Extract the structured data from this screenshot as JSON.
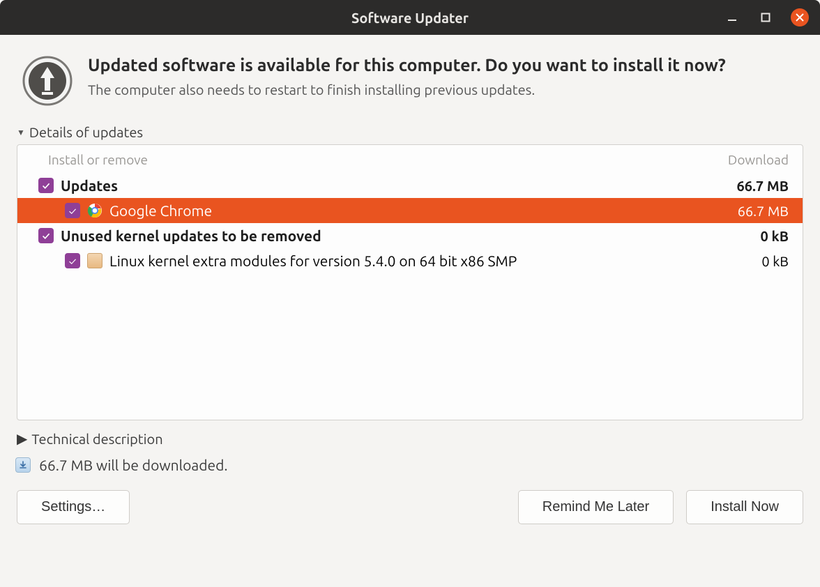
{
  "titlebar": {
    "title": "Software Updater"
  },
  "header": {
    "heading": "Updated software is available for this computer. Do you want to install it now?",
    "subheading": "The computer also needs to restart to finish installing previous updates."
  },
  "expanders": {
    "details": "Details of updates",
    "technical": "Technical description"
  },
  "columns": {
    "left": "Install or remove",
    "right": "Download"
  },
  "updates": {
    "group1": {
      "label": "Updates",
      "size": "66.7 MB"
    },
    "chrome": {
      "label": "Google Chrome",
      "size": "66.7 MB"
    },
    "group2": {
      "label": "Unused kernel updates to be removed",
      "size": "0 kB"
    },
    "kernel": {
      "label": "Linux kernel extra modules for version 5.4.0 on 64 bit x86 SMP",
      "size": "0 kB"
    }
  },
  "footer": {
    "download_text": "66.7 MB will be downloaded."
  },
  "buttons": {
    "settings": "Settings…",
    "remind": "Remind Me Later",
    "install": "Install Now"
  }
}
